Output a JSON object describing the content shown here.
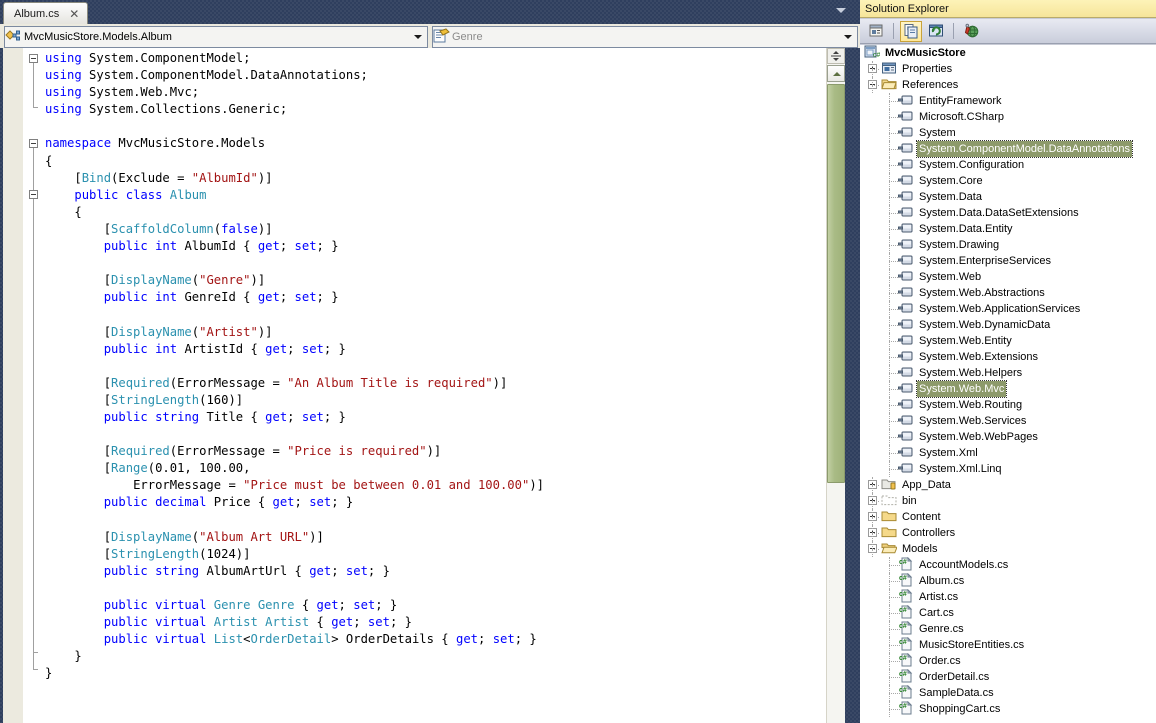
{
  "editor": {
    "tab": {
      "label": "Album.cs",
      "close_glyph": "✕",
      "close_name": "close-tab-icon"
    },
    "tabstrip_overflow_icon": "chevron-down-icon",
    "nav": {
      "type_dropdown": {
        "value": "MvcMusicStore.Models.Album",
        "icon": "class-icon"
      },
      "member_dropdown": {
        "value": "Genre",
        "icon": "member-list-icon"
      }
    },
    "code_lines": [
      "using System.ComponentModel;",
      "using System.ComponentModel.DataAnnotations;",
      "using System.Web.Mvc;",
      "using System.Collections.Generic;",
      "",
      "namespace MvcMusicStore.Models",
      "{",
      "    [Bind(Exclude = \"AlbumId\")]",
      "    public class Album",
      "    {",
      "        [ScaffoldColumn(false)]",
      "        public int AlbumId { get; set; }",
      "",
      "        [DisplayName(\"Genre\")]",
      "        public int GenreId { get; set; }",
      "",
      "        [DisplayName(\"Artist\")]",
      "        public int ArtistId { get; set; }",
      "",
      "        [Required(ErrorMessage = \"An Album Title is required\")]",
      "        [StringLength(160)]",
      "        public string Title { get; set; }",
      "",
      "        [Required(ErrorMessage = \"Price is required\")]",
      "        [Range(0.01, 100.00,",
      "            ErrorMessage = \"Price must be between 0.01 and 100.00\")]",
      "        public decimal Price { get; set; }",
      "",
      "        [DisplayName(\"Album Art URL\")]",
      "        [StringLength(1024)]",
      "        public string AlbumArtUrl { get; set; }",
      "",
      "        public virtual Genre Genre { get; set; }",
      "        public virtual Artist Artist { get; set; }",
      "        public virtual List<OrderDetail> OrderDetails { get; set; }",
      "    }",
      "}"
    ],
    "scrollbar": {
      "split_name": "scroll-split-button",
      "up_name": "scroll-up-button",
      "thumb_name": "scroll-thumb"
    }
  },
  "solution_explorer": {
    "title": "Solution Explorer",
    "toolbar": [
      {
        "name": "properties-window-button",
        "icon": "properties-icon",
        "active": false
      },
      {
        "name": "show-all-files-button",
        "icon": "show-all-files-icon",
        "active": true
      },
      {
        "name": "refresh-button",
        "icon": "refresh-icon",
        "active": false
      },
      {
        "name": "view-in-browser-button",
        "icon": "globe-icon",
        "active": false
      }
    ],
    "tree": [
      {
        "label": "MvcMusicStore",
        "depth": 0,
        "icon": "csharp-project-icon",
        "expander": "none",
        "bold": true
      },
      {
        "label": "Properties",
        "depth": 1,
        "icon": "properties-folder-icon",
        "expander": "plus"
      },
      {
        "label": "References",
        "depth": 1,
        "icon": "references-folder-icon",
        "expander": "minus"
      },
      {
        "label": "EntityFramework",
        "depth": 2,
        "icon": "assembly-icon"
      },
      {
        "label": "Microsoft.CSharp",
        "depth": 2,
        "icon": "assembly-icon"
      },
      {
        "label": "System",
        "depth": 2,
        "icon": "assembly-icon"
      },
      {
        "label": "System.ComponentModel.DataAnnotations",
        "depth": 2,
        "icon": "assembly-icon",
        "selected": true
      },
      {
        "label": "System.Configuration",
        "depth": 2,
        "icon": "assembly-icon"
      },
      {
        "label": "System.Core",
        "depth": 2,
        "icon": "assembly-icon"
      },
      {
        "label": "System.Data",
        "depth": 2,
        "icon": "assembly-icon"
      },
      {
        "label": "System.Data.DataSetExtensions",
        "depth": 2,
        "icon": "assembly-icon"
      },
      {
        "label": "System.Data.Entity",
        "depth": 2,
        "icon": "assembly-icon"
      },
      {
        "label": "System.Drawing",
        "depth": 2,
        "icon": "assembly-icon"
      },
      {
        "label": "System.EnterpriseServices",
        "depth": 2,
        "icon": "assembly-icon"
      },
      {
        "label": "System.Web",
        "depth": 2,
        "icon": "assembly-icon"
      },
      {
        "label": "System.Web.Abstractions",
        "depth": 2,
        "icon": "assembly-icon"
      },
      {
        "label": "System.Web.ApplicationServices",
        "depth": 2,
        "icon": "assembly-icon"
      },
      {
        "label": "System.Web.DynamicData",
        "depth": 2,
        "icon": "assembly-icon"
      },
      {
        "label": "System.Web.Entity",
        "depth": 2,
        "icon": "assembly-icon"
      },
      {
        "label": "System.Web.Extensions",
        "depth": 2,
        "icon": "assembly-icon"
      },
      {
        "label": "System.Web.Helpers",
        "depth": 2,
        "icon": "assembly-icon"
      },
      {
        "label": "System.Web.Mvc",
        "depth": 2,
        "icon": "assembly-icon",
        "selected": true
      },
      {
        "label": "System.Web.Routing",
        "depth": 2,
        "icon": "assembly-icon"
      },
      {
        "label": "System.Web.Services",
        "depth": 2,
        "icon": "assembly-icon"
      },
      {
        "label": "System.Web.WebPages",
        "depth": 2,
        "icon": "assembly-icon"
      },
      {
        "label": "System.Xml",
        "depth": 2,
        "icon": "assembly-icon"
      },
      {
        "label": "System.Xml.Linq",
        "depth": 2,
        "icon": "assembly-icon"
      },
      {
        "label": "App_Data",
        "depth": 1,
        "icon": "app-data-folder-icon",
        "expander": "plus"
      },
      {
        "label": "bin",
        "depth": 1,
        "icon": "bin-folder-icon",
        "expander": "plus"
      },
      {
        "label": "Content",
        "depth": 1,
        "icon": "folder-icon",
        "expander": "plus"
      },
      {
        "label": "Controllers",
        "depth": 1,
        "icon": "folder-icon",
        "expander": "plus"
      },
      {
        "label": "Models",
        "depth": 1,
        "icon": "open-folder-icon",
        "expander": "minus"
      },
      {
        "label": "AccountModels.cs",
        "depth": 2,
        "icon": "csharp-file-icon"
      },
      {
        "label": "Album.cs",
        "depth": 2,
        "icon": "csharp-file-icon"
      },
      {
        "label": "Artist.cs",
        "depth": 2,
        "icon": "csharp-file-icon"
      },
      {
        "label": "Cart.cs",
        "depth": 2,
        "icon": "csharp-file-icon"
      },
      {
        "label": "Genre.cs",
        "depth": 2,
        "icon": "csharp-file-icon"
      },
      {
        "label": "MusicStoreEntities.cs",
        "depth": 2,
        "icon": "csharp-file-icon"
      },
      {
        "label": "Order.cs",
        "depth": 2,
        "icon": "csharp-file-icon"
      },
      {
        "label": "OrderDetail.cs",
        "depth": 2,
        "icon": "csharp-file-icon"
      },
      {
        "label": "SampleData.cs",
        "depth": 2,
        "icon": "csharp-file-icon"
      },
      {
        "label": "ShoppingCart.cs",
        "depth": 2,
        "icon": "csharp-file-icon"
      }
    ]
  },
  "colors": {
    "keyword": "#0000ff",
    "type": "#2b91af",
    "string": "#a31515",
    "selection_green": "#8d9a6b",
    "title_yellow": "#f6e59a",
    "chrome_blue": "#2f3f5e"
  }
}
